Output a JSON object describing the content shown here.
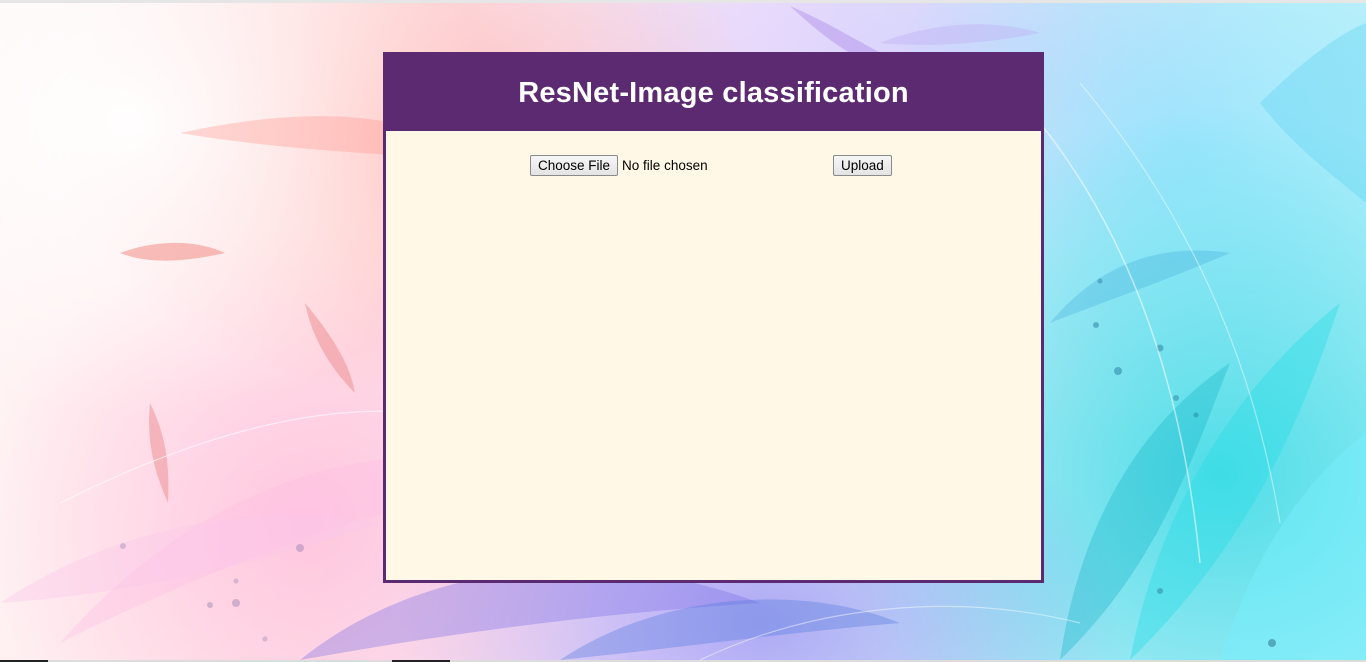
{
  "page": {
    "title": "ResNet-Image classification"
  },
  "upload_form": {
    "choose_file_label": "Choose File",
    "file_status": "No file chosen",
    "upload_label": "Upload"
  },
  "colors": {
    "header_bg": "#5c2a70",
    "card_bg": "#fff8e6",
    "title_text": "#ffffff"
  }
}
